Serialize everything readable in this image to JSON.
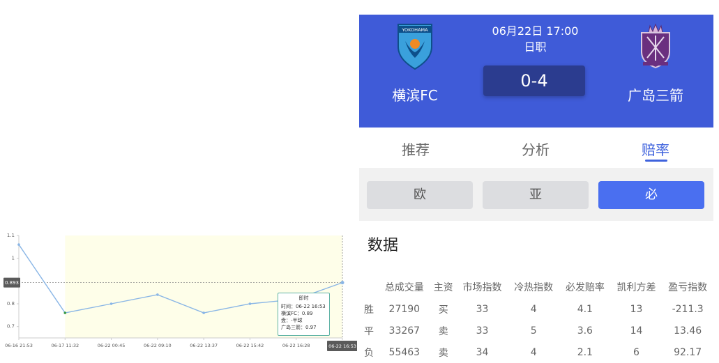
{
  "match": {
    "datetime": "06月22日 17:00",
    "league": "日职",
    "score": "0-4",
    "home": {
      "name": "横滨FC",
      "logo_text": "YOKOHAMA"
    },
    "away": {
      "name": "广岛三箭"
    }
  },
  "tabs": [
    {
      "label": "推荐",
      "active": false
    },
    {
      "label": "分析",
      "active": false
    },
    {
      "label": "赔率",
      "active": true
    }
  ],
  "subtabs": [
    {
      "label": "欧",
      "active": false
    },
    {
      "label": "亚",
      "active": false
    },
    {
      "label": "必",
      "active": true
    }
  ],
  "section_title": "数据",
  "table": {
    "headers": [
      "总成交量",
      "主资",
      "市场指数",
      "冷热指数",
      "必发赔率",
      "凯利方差",
      "盈亏指数"
    ],
    "rows": [
      {
        "label": "胜",
        "cells": [
          "27190",
          "买",
          "33",
          "4",
          "4.1",
          "13",
          "-211.3"
        ]
      },
      {
        "label": "平",
        "cells": [
          "33267",
          "卖",
          "33",
          "5",
          "3.6",
          "14",
          "13.46"
        ]
      },
      {
        "label": "负",
        "cells": [
          "55463",
          "卖",
          "34",
          "4",
          "2.1",
          "6",
          "92.17"
        ]
      }
    ]
  },
  "chart_data": {
    "type": "line",
    "x": [
      "06-16 21:53",
      "06-17 11:32",
      "06-22 00:45",
      "06-22 09:10",
      "06-22 13:37",
      "06-22 15:42",
      "06-22 16:28",
      "06-22 16:53"
    ],
    "y": [
      1.06,
      0.76,
      0.8,
      0.84,
      0.76,
      0.8,
      0.82,
      0.893
    ],
    "ylim": [
      0.65,
      1.1
    ],
    "yticks": [
      "1.1",
      "1",
      "0.8",
      "0.7"
    ],
    "ytick_values": [
      1.1,
      1.0,
      0.8,
      0.7
    ],
    "cursor_label": "0.893",
    "cursor_x_label": "06-22 16:53",
    "highlight_from_index": 1,
    "colors": {
      "line": "#8ab6e6",
      "highlight": "#fefee9",
      "marker_green": "#3c9b4b",
      "cursor_bg": "#5a5a5a"
    },
    "tooltip": {
      "title": "即时",
      "lines": [
        "时间：06-22 16:53",
        "横滨FC：0.89",
        "盘：-半球",
        "广岛三箭：0.97"
      ]
    }
  }
}
